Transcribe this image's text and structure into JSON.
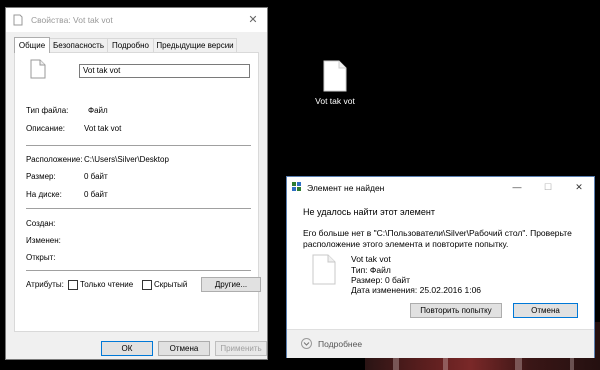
{
  "desktop": {
    "file_label": "Vot tak vot"
  },
  "props": {
    "title": "Свойства: Vot tak vot",
    "close": "✕",
    "tabs": [
      "Общие",
      "Безопасность",
      "Подробно",
      "Предыдущие версии"
    ],
    "name_value": "Vot tak vot",
    "type_label": "Тип файла:",
    "type_value": "Файл",
    "desc_label": "Описание:",
    "desc_value": "Vot tak vot",
    "loc_label": "Расположение:",
    "loc_value": "C:\\Users\\Silver\\Desktop",
    "size_label": "Размер:",
    "size_value": "0 байт",
    "disk_label": "На диске:",
    "disk_value": "0 байт",
    "created_label": "Создан:",
    "modified_label": "Изменен:",
    "opened_label": "Открыт:",
    "attrs_label": "Атрибуты:",
    "readonly_label": "Только чтение",
    "hidden_label": "Скрытый",
    "other_button": "Другие...",
    "ok_button": "ОК",
    "cancel_button": "Отмена",
    "apply_button": "Применить"
  },
  "dialog": {
    "title": "Элемент не найден",
    "min": "—",
    "max": "☐",
    "close": "✕",
    "heading": "Не удалось найти этот элемент",
    "message": "Его больше нет в \"C:\\Пользователи\\Silver\\Рабочий стол\". Проверьте расположение этого элемента и повторите попытку.",
    "file_name": "Vot tak vot",
    "file_type": "Тип: Файл",
    "file_size": "Размер: 0 байт",
    "file_date": "Дата изменения: 25.02.2016 1:06",
    "retry_button": "Повторить попытку",
    "cancel_button": "Отмена",
    "more": "Подробнее"
  },
  "colors": {
    "accent": "#0078d7",
    "desktop": "#000000",
    "window_bg": "#f0f0f0"
  }
}
